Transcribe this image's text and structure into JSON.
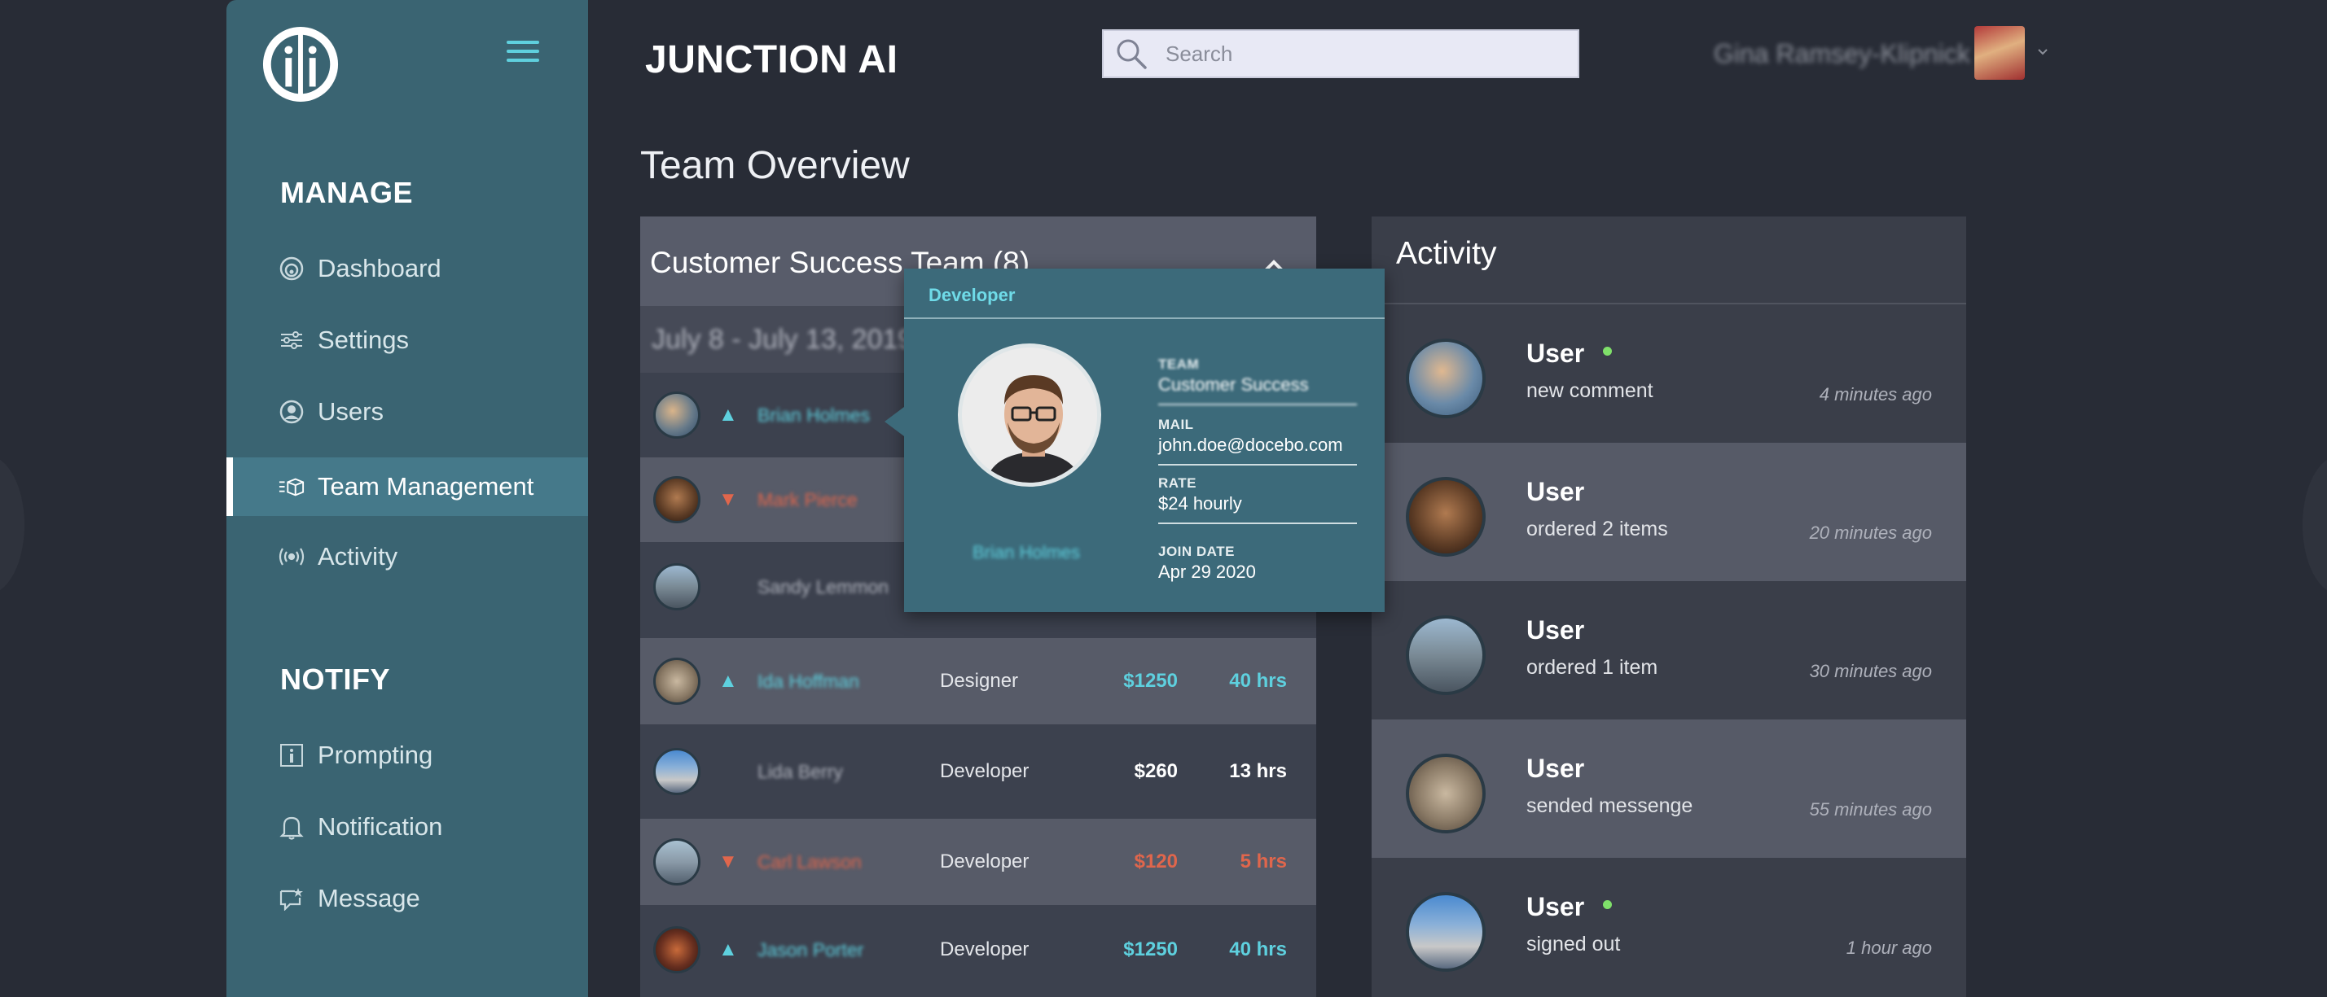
{
  "header": {
    "brand": "JUNCTION AI",
    "search_placeholder": "Search",
    "user_name": "Gina Ramsey-Klipnick"
  },
  "sidebar": {
    "manage_title": "MANAGE",
    "notify_title": "NOTIFY",
    "manage_items": [
      {
        "label": "Dashboard",
        "icon": "dashboard-icon"
      },
      {
        "label": "Settings",
        "icon": "sliders-icon"
      },
      {
        "label": "Users",
        "icon": "user-circle-icon"
      },
      {
        "label": "Team Management",
        "icon": "team-icon",
        "active": true
      },
      {
        "label": "Activity",
        "icon": "broadcast-icon"
      }
    ],
    "notify_items": [
      {
        "label": "Prompting",
        "icon": "info-icon"
      },
      {
        "label": "Notification",
        "icon": "bell-icon"
      },
      {
        "label": "Message",
        "icon": "message-icon"
      }
    ]
  },
  "page_title": "Team Overview",
  "team": {
    "title": "Customer Success Team (8)",
    "date_range": "July 8 - July 13, 2019",
    "members": [
      {
        "name": "Brian Holmes",
        "trend": "up",
        "role": "",
        "rate": "",
        "hours": ""
      },
      {
        "name": "Mark Pierce",
        "trend": "down",
        "role": "",
        "rate": "",
        "hours": ""
      },
      {
        "name": "Sandy Lemmon",
        "trend": "none",
        "role": "",
        "rate": "",
        "hours": ""
      },
      {
        "name": "Ida Hoffman",
        "trend": "up",
        "role": "Designer",
        "rate": "$1250",
        "hours": "40 hrs"
      },
      {
        "name": "Lida Berry",
        "trend": "none",
        "role": "Developer",
        "rate": "$260",
        "hours": "13 hrs"
      },
      {
        "name": "Carl Lawson",
        "trend": "down",
        "role": "Developer",
        "rate": "$120",
        "hours": "5 hrs"
      },
      {
        "name": "Jason Porter",
        "trend": "up",
        "role": "Developer",
        "rate": "$1250",
        "hours": "40 hrs"
      }
    ]
  },
  "popover": {
    "role": "Developer",
    "name": "Brian Holmes",
    "team_label": "TEAM",
    "team_value": "Customer Success",
    "mail_label": "MAIL",
    "mail_value": "john.doe@docebo.com",
    "rate_label": "RATE",
    "rate_value": "$24 hourly",
    "join_label": "JOIN DATE",
    "join_value": "Apr 29 2020"
  },
  "activity": {
    "title": "Activity",
    "items": [
      {
        "user": "User",
        "text": "new comment",
        "time": "4 minutes ago",
        "online": true
      },
      {
        "user": "User",
        "text": "ordered 2 items",
        "time": "20 minutes ago",
        "online": false
      },
      {
        "user": "User",
        "text": "ordered 1 item",
        "time": "30 minutes ago",
        "online": false
      },
      {
        "user": "User",
        "text": "sended messenge",
        "time": "55 minutes ago",
        "online": false
      },
      {
        "user": "User",
        "text": "signed out",
        "time": "1 hour ago",
        "online": true
      }
    ]
  },
  "colors": {
    "sidebar": "#3a6472",
    "accent": "#5ed0de",
    "down": "#e0664c",
    "online": "#7fe06a"
  }
}
